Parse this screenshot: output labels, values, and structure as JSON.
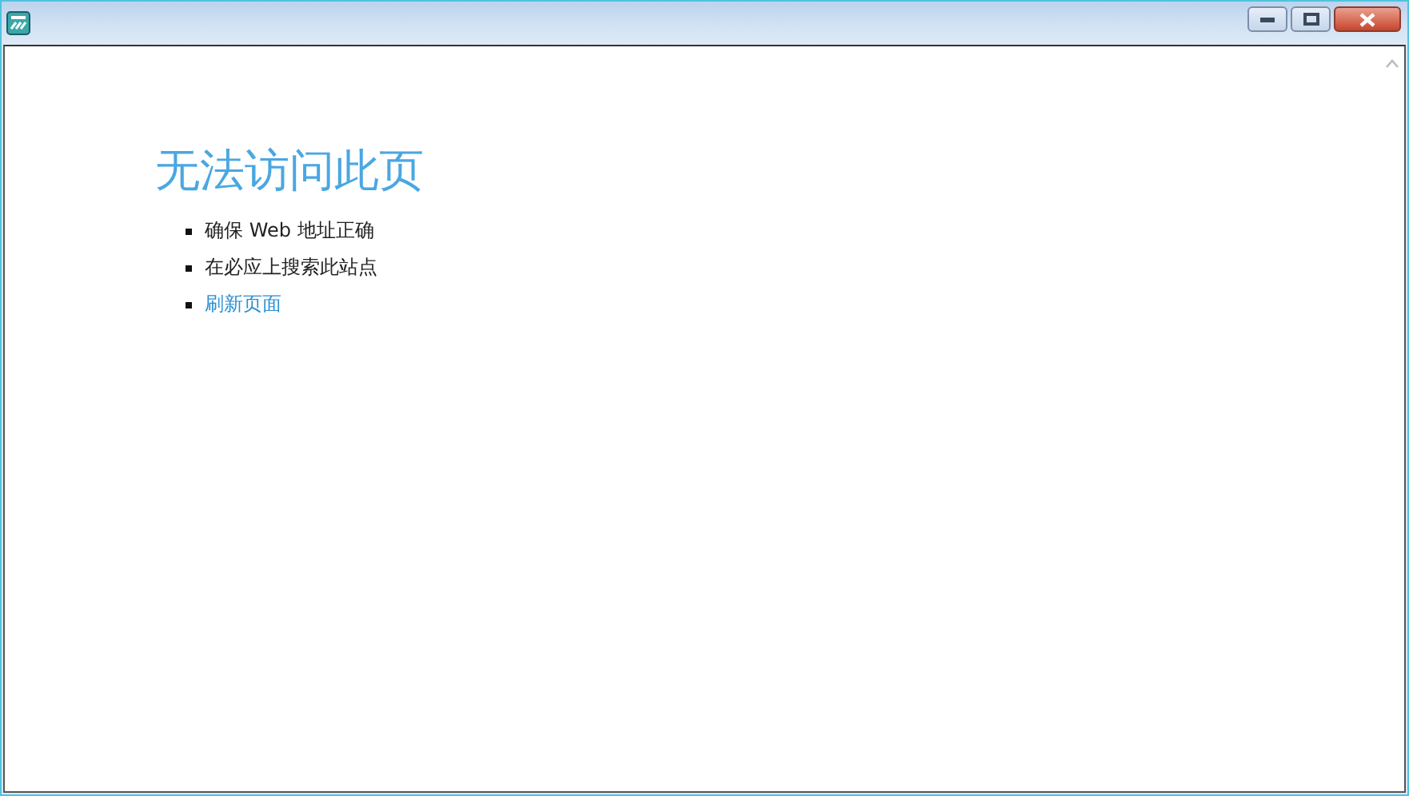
{
  "page": {
    "heading": "无法访问此页",
    "items": [
      {
        "kind": "text",
        "text": "确保 Web 地址正确"
      },
      {
        "kind": "text",
        "text": "在必应上搜索此站点"
      },
      {
        "kind": "link",
        "text": "刷新页面"
      }
    ]
  }
}
